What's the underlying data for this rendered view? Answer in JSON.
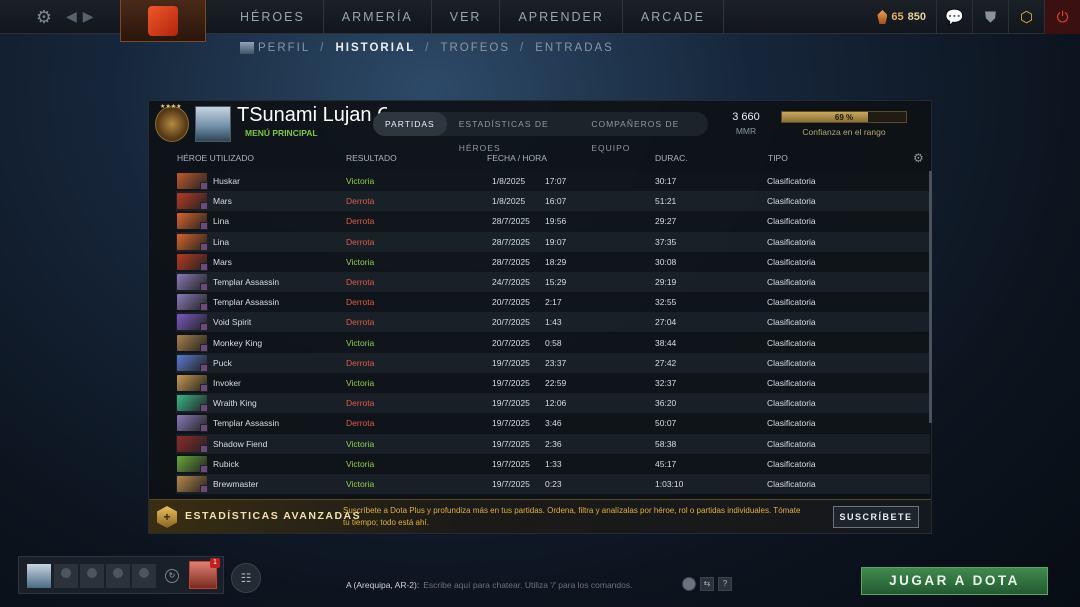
{
  "topbar": {
    "nav": [
      "HÉROES",
      "ARMERÍA",
      "VER",
      "APRENDER",
      "ARCADE"
    ],
    "shards_level": "65",
    "shards_count": "850",
    "icons": [
      "settings-icon",
      "back-icon",
      "forward-icon",
      "chat-icon",
      "armory-icon",
      "dota-plus-icon",
      "power-icon"
    ]
  },
  "subnav": {
    "tabs": [
      "PERFIL",
      "HISTORIAL",
      "TROFEOS",
      "ENTRADAS"
    ],
    "separator": "/"
  },
  "profile": {
    "name": "TSunami Lujan C",
    "status": "MENÚ PRINCIPAL",
    "tabs": [
      "PARTIDAS",
      "ESTADÍSTICAS DE HÉROES",
      "COMPAÑEROS DE EQUIPO"
    ],
    "mmr_value": "3 660",
    "mmr_label": "MMR",
    "confidence_pct": "69 %",
    "confidence_value": 0.69,
    "confidence_label": "Confianza en el rango"
  },
  "table": {
    "headers": {
      "hero": "HÉROE UTILIZADO",
      "result": "RESULTADO",
      "date": "FECHA / HORA",
      "duration": "DURAC.",
      "type": "TIPO"
    },
    "rows": [
      {
        "hero": "Huskar",
        "result": "Victoria",
        "win": true,
        "date": "1/8/2025",
        "time": "17:07",
        "duration": "30:17",
        "type": "Clasificatoria",
        "color": "#c05a2a"
      },
      {
        "hero": "Mars",
        "result": "Derrota",
        "win": false,
        "date": "1/8/2025",
        "time": "16:07",
        "duration": "51:21",
        "type": "Clasificatoria",
        "color": "#b83a22"
      },
      {
        "hero": "Lina",
        "result": "Derrota",
        "win": false,
        "date": "28/7/2025",
        "time": "19:56",
        "duration": "29:27",
        "type": "Clasificatoria",
        "color": "#d8642a"
      },
      {
        "hero": "Lina",
        "result": "Derrota",
        "win": false,
        "date": "28/7/2025",
        "time": "19:07",
        "duration": "37:35",
        "type": "Clasificatoria",
        "color": "#d8642a"
      },
      {
        "hero": "Mars",
        "result": "Victoria",
        "win": true,
        "date": "28/7/2025",
        "time": "18:29",
        "duration": "30:08",
        "type": "Clasificatoria",
        "color": "#b83a22"
      },
      {
        "hero": "Templar Assassin",
        "result": "Derrota",
        "win": false,
        "date": "24/7/2025",
        "time": "15:29",
        "duration": "29:19",
        "type": "Clasificatoria",
        "color": "#8a7ab8"
      },
      {
        "hero": "Templar Assassin",
        "result": "Derrota",
        "win": false,
        "date": "20/7/2025",
        "time": "2:17",
        "duration": "32:55",
        "type": "Clasificatoria",
        "color": "#8a7ab8"
      },
      {
        "hero": "Void Spirit",
        "result": "Derrota",
        "win": false,
        "date": "20/7/2025",
        "time": "1:43",
        "duration": "27:04",
        "type": "Clasificatoria",
        "color": "#7a5ac0"
      },
      {
        "hero": "Monkey King",
        "result": "Victoria",
        "win": true,
        "date": "20/7/2025",
        "time": "0:58",
        "duration": "38:44",
        "type": "Clasificatoria",
        "color": "#a8804a"
      },
      {
        "hero": "Puck",
        "result": "Derrota",
        "win": false,
        "date": "19/7/2025",
        "time": "23:37",
        "duration": "27:42",
        "type": "Clasificatoria",
        "color": "#5a7ad0"
      },
      {
        "hero": "Invoker",
        "result": "Victoria",
        "win": true,
        "date": "19/7/2025",
        "time": "22:59",
        "duration": "32:37",
        "type": "Clasificatoria",
        "color": "#c89a50"
      },
      {
        "hero": "Wraith King",
        "result": "Derrota",
        "win": false,
        "date": "19/7/2025",
        "time": "12:06",
        "duration": "36:20",
        "type": "Clasificatoria",
        "color": "#3ab88a"
      },
      {
        "hero": "Templar Assassin",
        "result": "Derrota",
        "win": false,
        "date": "19/7/2025",
        "time": "3:46",
        "duration": "50:07",
        "type": "Clasificatoria",
        "color": "#8a7ab8"
      },
      {
        "hero": "Shadow Fiend",
        "result": "Victoria",
        "win": true,
        "date": "19/7/2025",
        "time": "2:36",
        "duration": "58:38",
        "type": "Clasificatoria",
        "color": "#902a2a"
      },
      {
        "hero": "Rubick",
        "result": "Victoria",
        "win": true,
        "date": "19/7/2025",
        "time": "1:33",
        "duration": "45:17",
        "type": "Clasificatoria",
        "color": "#6aa83a"
      },
      {
        "hero": "Brewmaster",
        "result": "Victoria",
        "win": true,
        "date": "19/7/2025",
        "time": "0:23",
        "duration": "1:03:10",
        "type": "Clasificatoria",
        "color": "#b88a4a"
      }
    ]
  },
  "dota_plus": {
    "title": "ESTADÍSTICAS AVANZADAS",
    "description": "Suscríbete a Dota Plus y profundiza más en tus partidas. Ordena, filtra y analízalas por héroe, rol o partidas individuales. Tómate tu tiempo; todo está ahí.",
    "button": "SUSCRÍBETE"
  },
  "bottom": {
    "invite_count": "1",
    "chat_channel": "A (Arequipa, AR-2):",
    "chat_placeholder": "Escribe aquí para chatear. Utiliza '/' para los comandos.",
    "help": "?",
    "play_button": "JUGAR A DOTA"
  }
}
